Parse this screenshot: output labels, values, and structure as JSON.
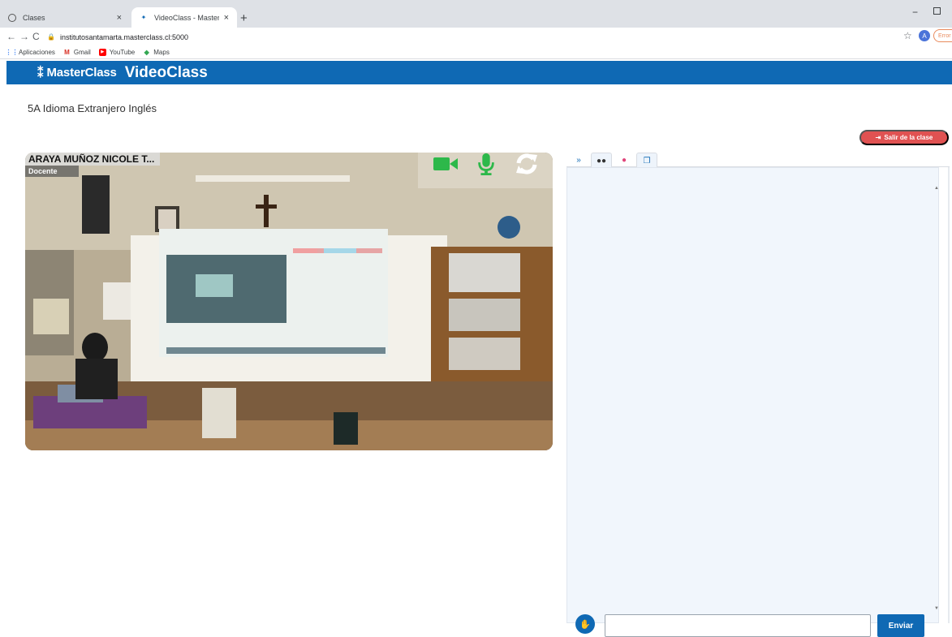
{
  "browser": {
    "tabs": [
      {
        "title": "Clases",
        "icon": "globe-icon",
        "active": false
      },
      {
        "title": "VideoClass - MasterClass",
        "icon": "masterclass-icon",
        "active": true
      }
    ],
    "new_tab_symbol": "+",
    "window_min_symbol": "−",
    "url": "institutosantamarta.masterclass.cl:5000",
    "profile_initial": "A",
    "error_label": "Error",
    "bookmarks": [
      {
        "label": "Aplicaciones",
        "icon": "apps-grid-icon"
      },
      {
        "label": "Gmail",
        "icon": "gmail-icon"
      },
      {
        "label": "YouTube",
        "icon": "youtube-icon"
      },
      {
        "label": "Maps",
        "icon": "maps-icon"
      }
    ]
  },
  "header": {
    "brand": "MasterClass",
    "product": "VideoClass",
    "background": "#0f69b4"
  },
  "class": {
    "title": "5A Idioma Extranjero Inglés"
  },
  "exit_button": {
    "label": "Salir  de la clase",
    "color": "#e05252"
  },
  "video": {
    "participant_name": "ARAYA MUÑOZ NICOLE T...",
    "role": "Docente",
    "controls": [
      "camera-icon",
      "microphone-icon",
      "refresh-icon"
    ],
    "control_color": "#2db84a"
  },
  "side_panel": {
    "tabs": [
      {
        "name": "collapse-icon",
        "glyph": "»"
      },
      {
        "name": "chat-icon",
        "glyph": "💬"
      },
      {
        "name": "record-icon",
        "glyph": "●"
      },
      {
        "name": "windows-icon",
        "glyph": "🗗"
      }
    ],
    "message_placeholder": "",
    "message_value": "",
    "send_label": "Enviar"
  }
}
